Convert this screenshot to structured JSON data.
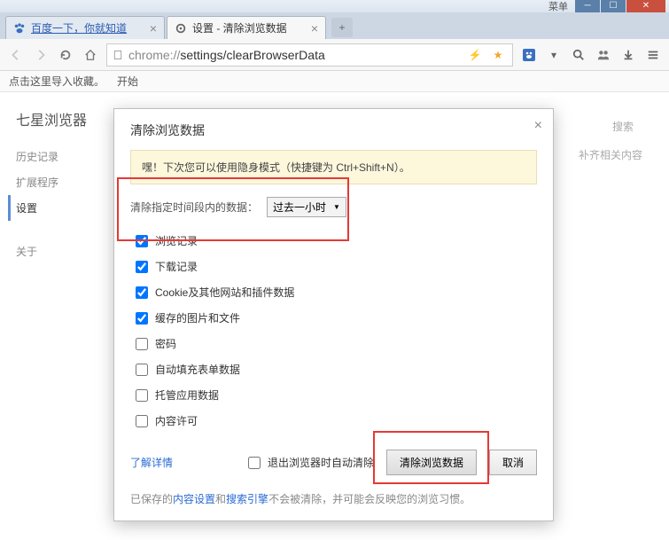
{
  "titlebar": {
    "menu": "菜单"
  },
  "tabs": [
    {
      "title": "百度一下，你就知道",
      "favicon": "paw"
    },
    {
      "title": "设置 - 清除浏览数据",
      "favicon": "gear"
    }
  ],
  "toolbar": {
    "url_host": "chrome://",
    "url_path": "settings/clearBrowserData"
  },
  "bookbar": {
    "import": "点击这里导入收藏。",
    "start": "开始"
  },
  "sidebar": {
    "brand": "七星浏览器",
    "items": [
      "历史记录",
      "扩展程序",
      "设置",
      "关于"
    ],
    "active_index": 2
  },
  "bg": {
    "search_ph": "搜索",
    "text2": "补齐相关内容"
  },
  "dialog": {
    "title": "清除浏览数据",
    "tip": "嘿！下次您可以使用隐身模式（快捷键为 Ctrl+Shift+N）。",
    "period_label": "清除指定时间段内的数据：",
    "period_value": "过去一小时",
    "checks": [
      {
        "label": "浏览记录",
        "checked": true
      },
      {
        "label": "下载记录",
        "checked": true
      },
      {
        "label": "Cookie及其他网站和插件数据",
        "checked": true
      },
      {
        "label": "缓存的图片和文件",
        "checked": true
      },
      {
        "label": "密码",
        "checked": false
      },
      {
        "label": "自动填充表单数据",
        "checked": false
      },
      {
        "label": "托管应用数据",
        "checked": false
      },
      {
        "label": "内容许可",
        "checked": false
      }
    ],
    "learn_more": "了解详情",
    "exit_clear": "退出浏览器时自动清除",
    "clear_btn": "清除浏览数据",
    "cancel_btn": "取消",
    "saved_note_pre": "已保存的",
    "saved_note_link1": "内容设置",
    "saved_note_mid": "和",
    "saved_note_link2": "搜索引擎",
    "saved_note_post": "不会被清除，并可能会反映您的浏览习惯。"
  }
}
